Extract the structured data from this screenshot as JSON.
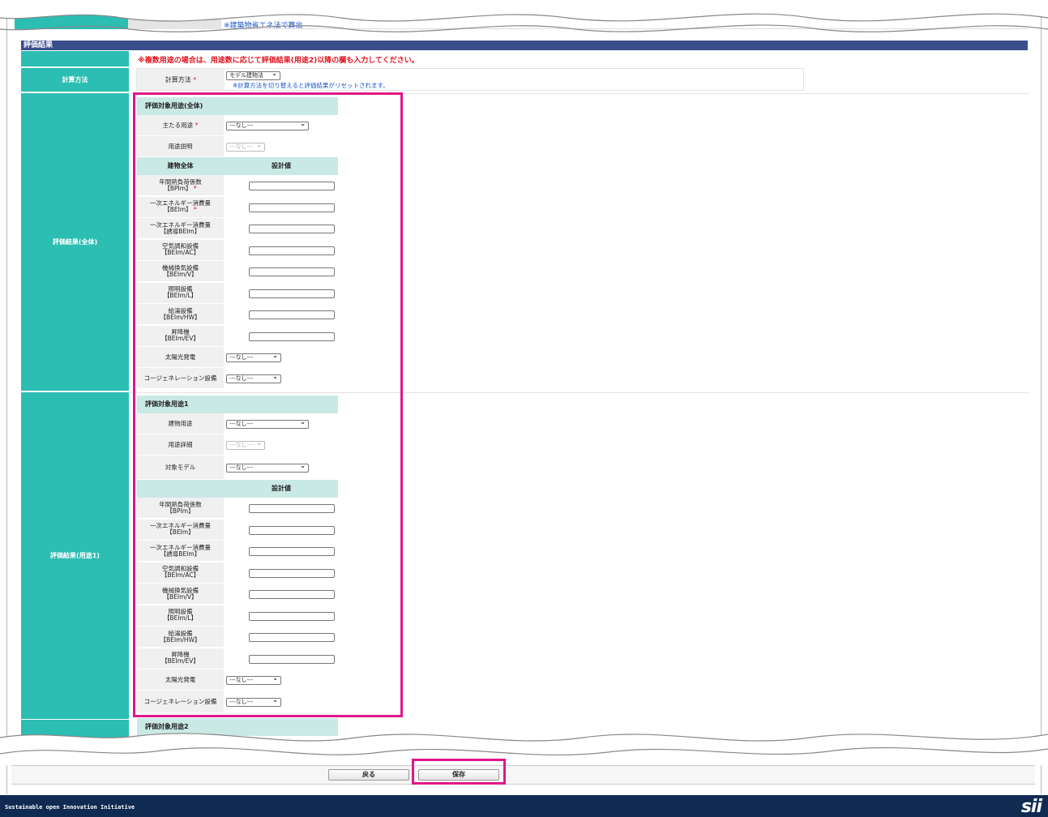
{
  "top": {
    "note": "※建築物省エネ法で算出"
  },
  "section_title": "評価結果",
  "warning": "※複数用途の場合は、用途数に応じて評価結果(用途2)以降の欄も入力してください。",
  "method": {
    "side_label": "計算方法",
    "label": "計算方法",
    "required": "*",
    "select_value": "モデル建物法",
    "note": "※計算方法を切り替えると評価結果がリセットされます。"
  },
  "overall": {
    "side_label": "評価結果(全体)",
    "heading": "評価対象用途(全体)",
    "main_use_label": "主たる用途",
    "main_use_value": "---なし---",
    "use_desc_label": "用途説明",
    "use_desc_value": "---なし---",
    "col1": "建物全体",
    "col2": "設計値",
    "fields": [
      {
        "l1": "年間熱負荷係数",
        "l2": "【BPIm】",
        "req": "*"
      },
      {
        "l1": "一次エネルギー消費量",
        "l2": "【BEIm】",
        "req": "*"
      },
      {
        "l1": "一次エネルギー消費量",
        "l2": "【誘導BEIm】",
        "req": ""
      },
      {
        "l1": "空気調和設備",
        "l2": "【BEIm/AC】",
        "req": ""
      },
      {
        "l1": "機械換気設備",
        "l2": "【BEIm/V】",
        "req": ""
      },
      {
        "l1": "照明設備",
        "l2": "【BEIm/L】",
        "req": ""
      },
      {
        "l1": "給湯設備",
        "l2": "【BEIm/HW】",
        "req": ""
      },
      {
        "l1": "昇降機",
        "l2": "【BEIm/EV】",
        "req": ""
      }
    ],
    "solar_label": "太陽光発電",
    "solar_value": "---なし---",
    "cogen_label": "コージェネレーション設備",
    "cogen_value": "---なし---"
  },
  "use1": {
    "side_label": "評価結果(用途1)",
    "heading": "評価対象用途1",
    "building_use_label": "建物用途",
    "building_use_value": "---なし---",
    "detail_label": "用途詳細",
    "detail_value": "---なし---",
    "model_label": "対象モデル",
    "model_value": "---なし---",
    "col2": "設計値",
    "fields": [
      {
        "l1": "年間熱負荷係数",
        "l2": "【BPIm】"
      },
      {
        "l1": "一次エネルギー消費量",
        "l2": "【BEIm】"
      },
      {
        "l1": "一次エネルギー消費量",
        "l2": "【誘導BEIm】"
      },
      {
        "l1": "空気調和設備",
        "l2": "【BEIm/AC】"
      },
      {
        "l1": "機械換気設備",
        "l2": "【BEIm/V】"
      },
      {
        "l1": "照明設備",
        "l2": "【BEIm/L】"
      },
      {
        "l1": "給湯設備",
        "l2": "【BEIm/HW】"
      },
      {
        "l1": "昇降機",
        "l2": "【BEIm/EV】"
      }
    ],
    "solar_label": "太陽光発電",
    "solar_value": "---なし---",
    "cogen_label": "コージェネレーション設備",
    "cogen_value": "---なし---"
  },
  "use2": {
    "heading": "評価対象用途2"
  },
  "buttons": {
    "back": "戻る",
    "save": "保存"
  },
  "footer": {
    "tagline": "Sustainable open Innovation Initiative",
    "logo": "sii"
  },
  "colors": {
    "teal": "#2cbdb3",
    "navy": "#3a4e8a",
    "highlight": "#e0168a",
    "required": "#e0131c"
  }
}
